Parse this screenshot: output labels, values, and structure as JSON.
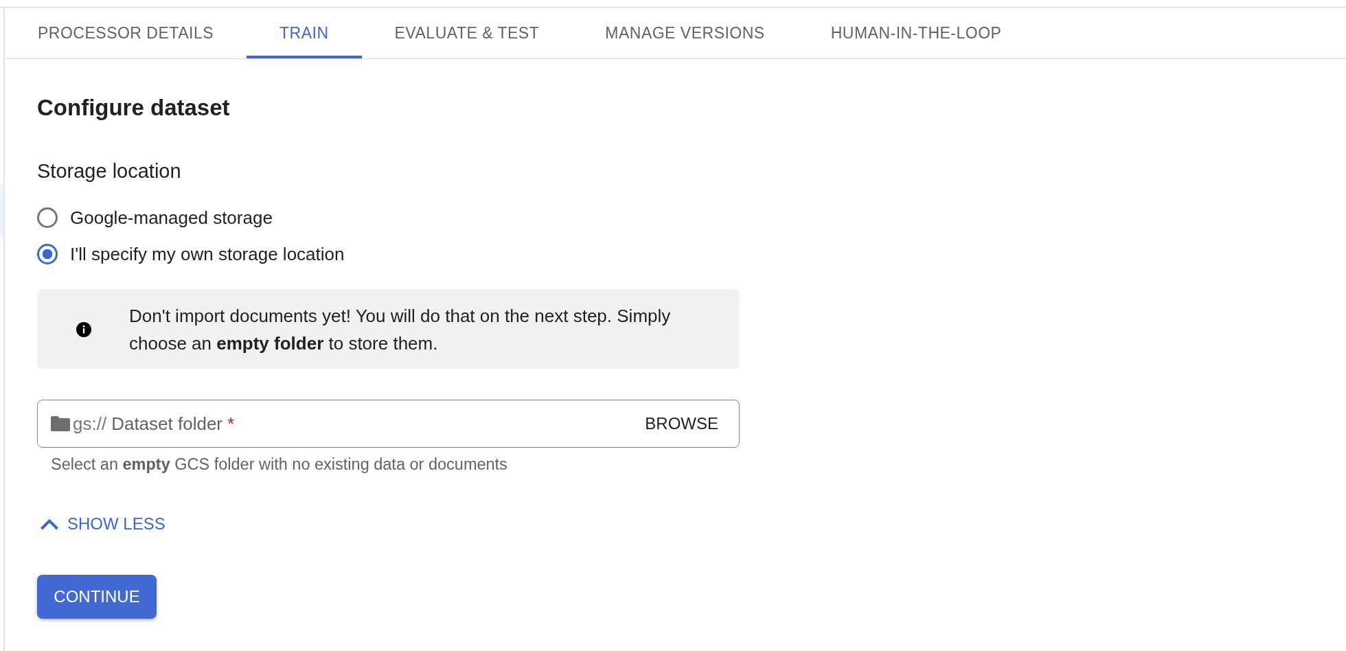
{
  "tabs": [
    {
      "label": "PROCESSOR DETAILS",
      "selected": false
    },
    {
      "label": "TRAIN",
      "selected": true
    },
    {
      "label": "EVALUATE & TEST",
      "selected": false
    },
    {
      "label": "MANAGE VERSIONS",
      "selected": false
    },
    {
      "label": "HUMAN-IN-THE-LOOP",
      "selected": false
    }
  ],
  "title": "Configure dataset",
  "storage": {
    "heading": "Storage location",
    "options": [
      {
        "label": "Google-managed storage",
        "selected": false
      },
      {
        "label": "I'll specify my own storage location",
        "selected": true
      }
    ]
  },
  "notice": {
    "text": "Don't import documents yet! You will do that on the next step. Simply choose an **empty folder** to store them."
  },
  "folder_field": {
    "prefix": "gs://",
    "placeholder": "Dataset folder",
    "required_mark": "*",
    "button": "BROWSE",
    "hint": "Select an **empty** GCS folder with no existing data or documents"
  },
  "toggle": {
    "label": "SHOW LESS",
    "expanded": true
  },
  "continue_button": "CONTINUE"
}
